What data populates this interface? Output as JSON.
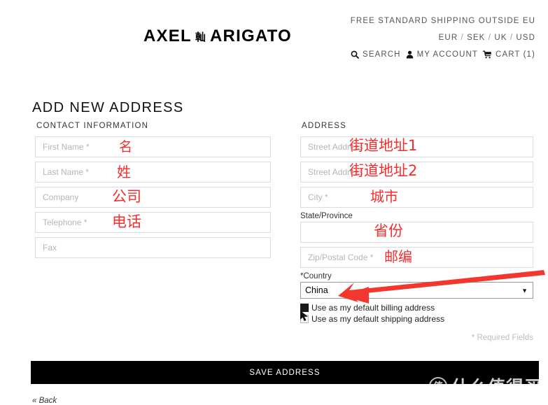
{
  "header": {
    "logo_left": "AXEL",
    "logo_mark": "軕",
    "logo_right": "ARIGATO",
    "shipping_note": "FREE STANDARD SHIPPING OUTSIDE EU",
    "currencies": [
      "EUR",
      "SEK",
      "UK",
      "USD"
    ],
    "currency_separator": "/",
    "search_label": "SEARCH",
    "account_label": "MY ACCOUNT",
    "cart_label": "CART (1)"
  },
  "page_title": "ADD NEW ADDRESS",
  "contact": {
    "heading": "CONTACT INFORMATION",
    "fields": [
      {
        "placeholder": "First Name *",
        "value": "",
        "annotation": "名"
      },
      {
        "placeholder": "Last Name *",
        "value": "",
        "annotation": "姓"
      },
      {
        "placeholder": "Company",
        "value": "",
        "annotation": "公司"
      },
      {
        "placeholder": "Telephone *",
        "value": "",
        "annotation": "电话"
      },
      {
        "placeholder": "Fax",
        "value": "",
        "annotation": ""
      }
    ]
  },
  "address": {
    "heading": "ADDRESS",
    "fields": [
      {
        "placeholder": "Street Address *",
        "value": "",
        "annotation": "街道地址1"
      },
      {
        "placeholder": "Street Address",
        "value": "",
        "annotation": "街道地址2"
      },
      {
        "placeholder": "City *",
        "value": "",
        "annotation": "城市"
      }
    ],
    "state_label": "State/Province",
    "state_placeholder": "",
    "state_value": "",
    "state_annotation": "省份",
    "zip_placeholder": "Zip/Postal Code *",
    "zip_value": "",
    "zip_annotation": "邮编",
    "country_label": "*Country",
    "country_value": "China",
    "country_options": [
      "China"
    ],
    "dropdown_arrow": "▼"
  },
  "options": {
    "billing_label": "Use as my default billing address",
    "billing_checked": true,
    "shipping_label": "Use as my default shipping address",
    "shipping_checked": false
  },
  "required_note": "* Required Fields",
  "save_label": "SAVE ADDRESS",
  "back_label": "« Back",
  "watermark": {
    "badge": "值",
    "text": "什么值得买"
  },
  "colors": {
    "annotation_red": "#f72c2c",
    "arrow_red": "#f4372e",
    "save_bar": "#000000",
    "placeholder": "#b5b5b5",
    "field_border": "#dcdcdc"
  }
}
